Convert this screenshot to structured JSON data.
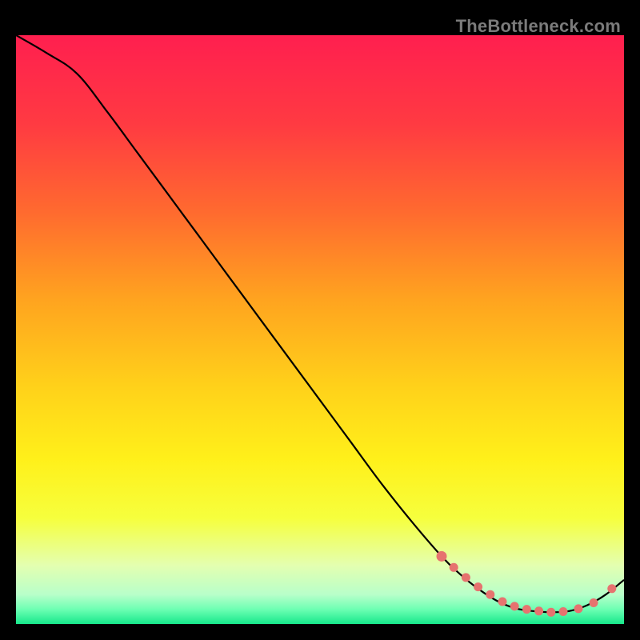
{
  "watermark": "TheBottleneck.com",
  "chart_data": {
    "type": "line",
    "title": "",
    "xlabel": "",
    "ylabel": "",
    "xlim": [
      0,
      100
    ],
    "ylim": [
      0,
      100
    ],
    "series": [
      {
        "name": "curve",
        "x": [
          0,
          5,
          10,
          15,
          20,
          25,
          30,
          35,
          40,
          45,
          50,
          55,
          60,
          65,
          70,
          73,
          76,
          79,
          82,
          85,
          88,
          91,
          94,
          97,
          100
        ],
        "y": [
          100,
          97,
          93.5,
          87,
          80,
          73,
          66,
          59,
          52,
          45,
          38,
          31,
          24,
          17.5,
          11.5,
          8.5,
          6,
          4,
          2.7,
          2.2,
          2.0,
          2.2,
          3.2,
          5.0,
          7.5
        ]
      }
    ],
    "markers": {
      "name": "dots",
      "color": "#e6736f",
      "x": [
        70,
        72,
        74,
        76,
        78,
        80,
        82,
        84,
        86,
        88,
        90,
        92.5,
        95,
        98
      ],
      "y": [
        11.5,
        9.6,
        7.9,
        6.3,
        5.0,
        3.8,
        3.0,
        2.5,
        2.2,
        2.0,
        2.1,
        2.6,
        3.6,
        6.0
      ]
    },
    "gradient_stops": [
      {
        "offset": 0.0,
        "color": "#ff1f4f"
      },
      {
        "offset": 0.15,
        "color": "#ff3a42"
      },
      {
        "offset": 0.3,
        "color": "#ff6a2f"
      },
      {
        "offset": 0.45,
        "color": "#ffa41f"
      },
      {
        "offset": 0.6,
        "color": "#ffd21a"
      },
      {
        "offset": 0.72,
        "color": "#fff01a"
      },
      {
        "offset": 0.82,
        "color": "#f6ff3d"
      },
      {
        "offset": 0.9,
        "color": "#e4ffb0"
      },
      {
        "offset": 0.95,
        "color": "#b8ffca"
      },
      {
        "offset": 0.975,
        "color": "#6dffb3"
      },
      {
        "offset": 1.0,
        "color": "#17e88b"
      }
    ]
  }
}
